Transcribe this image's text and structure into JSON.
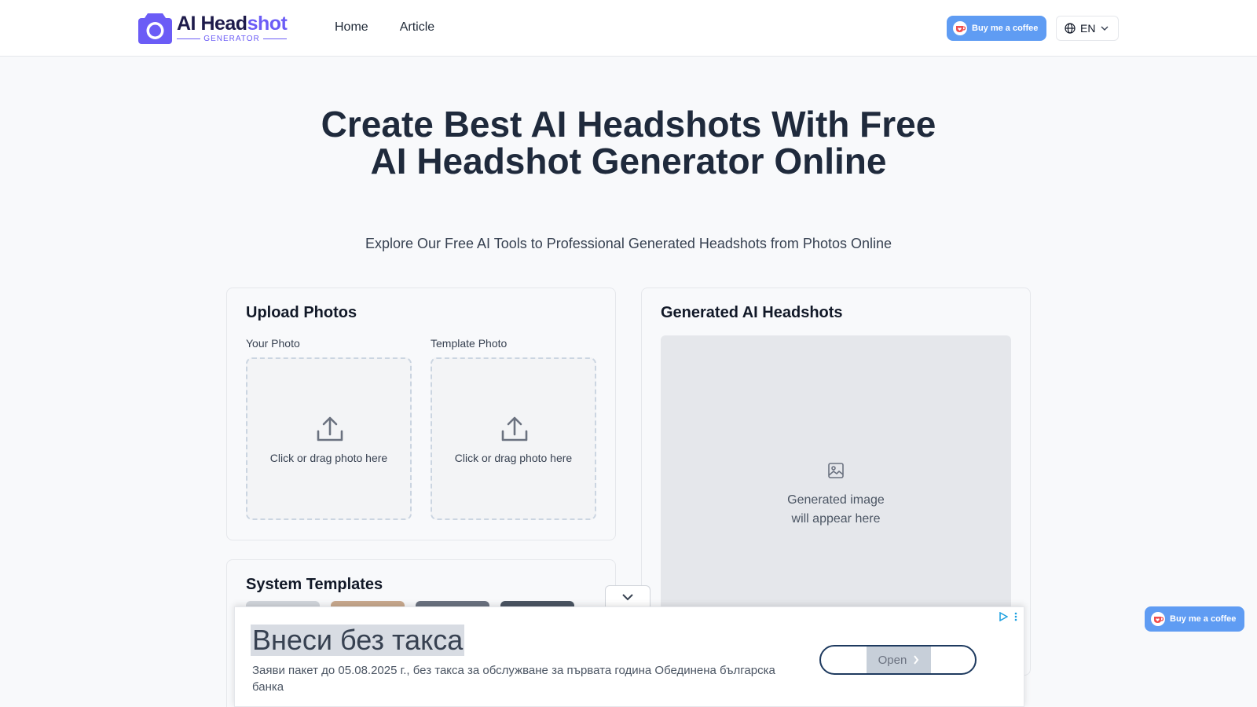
{
  "header": {
    "logo": {
      "main": "AI Head",
      "accent": "shot",
      "sub": "GENERATOR"
    },
    "nav": [
      {
        "label": "Home"
      },
      {
        "label": "Article"
      }
    ],
    "coffee_label": "Buy me a coffee",
    "language": "EN"
  },
  "hero": {
    "title": "Create Best AI Headshots With Free AI Headshot Generator Online",
    "subtitle": "Explore Our Free AI Tools to Professional Generated Headshots from Photos Online"
  },
  "upload": {
    "title": "Upload Photos",
    "your_photo_label": "Your Photo",
    "template_photo_label": "Template Photo",
    "dropzone_text": "Click or drag photo here"
  },
  "generated": {
    "title": "Generated AI Headshots",
    "placeholder_line1": "Generated image",
    "placeholder_line2": "will appear here"
  },
  "templates": {
    "title": "System Templates"
  },
  "ad": {
    "title": "Внеси без такса",
    "description": "Заяви пакет до 05.08.2025 г., без такса за обслужване за първата година Обединена българска банка",
    "open_label": "Open"
  },
  "floating": {
    "coffee_label": "Buy me a coffee"
  },
  "colors": {
    "brand": "#6b5cf6",
    "coffee": "#5f9cf3",
    "heading": "#1f2a3c"
  },
  "icons": {
    "logo": "camera-icon",
    "language": "globe-icon",
    "upload": "upload-icon",
    "placeholder": "image-icon",
    "collapse": "chevron-down-icon",
    "ad_open": "chevron-right-icon",
    "ad_choices": "adchoices-icon"
  }
}
